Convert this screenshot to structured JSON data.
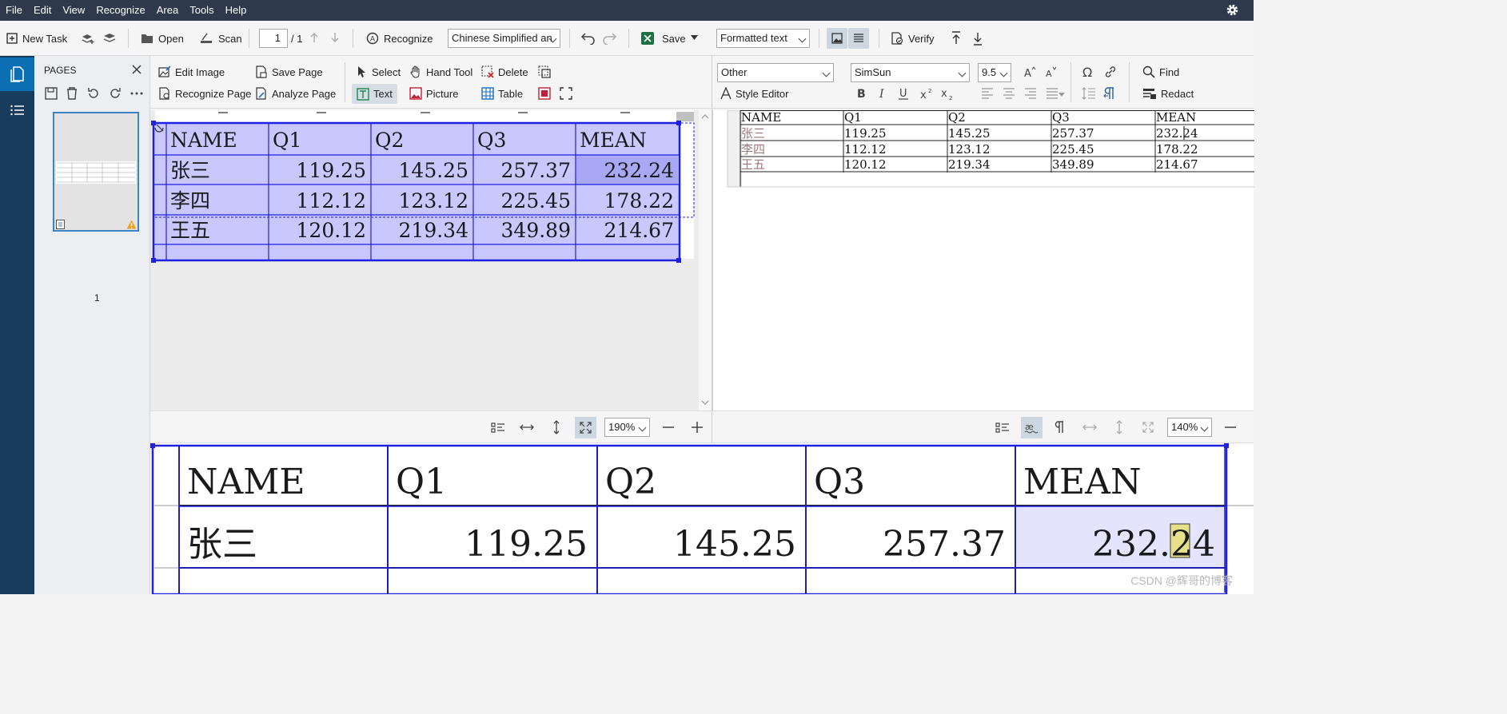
{
  "menu": {
    "items": [
      "File",
      "Edit",
      "View",
      "Recognize",
      "Area",
      "Tools",
      "Help"
    ]
  },
  "toolbar": {
    "new_task": "New Task",
    "open": "Open",
    "scan": "Scan",
    "page_current": "1",
    "page_total": "/ 1",
    "recognize": "Recognize",
    "language": "Chinese Simplified an",
    "save": "Save",
    "format": "Formatted text",
    "verify": "Verify"
  },
  "pages_panel": {
    "title": "PAGES",
    "page_number": "1"
  },
  "image_ribbon": {
    "edit_image": "Edit Image",
    "save_page": "Save Page",
    "select": "Select",
    "hand_tool": "Hand Tool",
    "delete": "Delete",
    "recognize_page": "Recognize Page",
    "analyze_page": "Analyze Page",
    "text": "Text",
    "picture": "Picture",
    "table": "Table"
  },
  "text_ribbon": {
    "style": "Other",
    "font": "SimSun",
    "size": "9.5",
    "style_editor": "Style Editor",
    "find": "Find",
    "redact": "Redact"
  },
  "table": {
    "header": [
      "NAME",
      "Q1",
      "Q2",
      "Q3",
      "MEAN"
    ],
    "rows": [
      [
        "张三",
        "119.25",
        "145.25",
        "257.37",
        "232.24"
      ],
      [
        "李四",
        "112.12",
        "123.12",
        "225.45",
        "178.22"
      ],
      [
        "王五",
        "120.12",
        "219.34",
        "349.89",
        "214.67"
      ]
    ]
  },
  "zoom": {
    "image_zoom": "190%",
    "text_zoom": "140%"
  },
  "watermark": "CSDN @辉哥的博客",
  "colors": {
    "menubar": "#2e3a4b",
    "leftrail": "#173c5c",
    "selection": "#2020e0",
    "selection_fill": "#c8c8ff"
  }
}
